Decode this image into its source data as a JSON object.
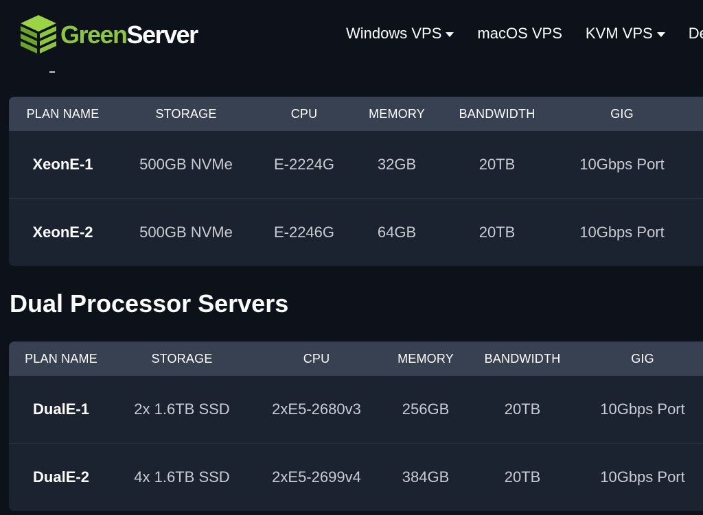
{
  "brand": {
    "name_green": "Green",
    "name_white": "Server",
    "accent_color": "#8cc63f",
    "logo_icon": "stacked-cube-icon"
  },
  "nav": {
    "items": [
      {
        "label": "Windows VPS",
        "has_dropdown": true
      },
      {
        "label": "macOS VPS",
        "has_dropdown": false
      },
      {
        "label": "KVM VPS",
        "has_dropdown": true
      },
      {
        "label": "De",
        "has_dropdown": false
      }
    ]
  },
  "tables": {
    "xeon": {
      "headers": [
        "PLAN NAME",
        "STORAGE",
        "CPU",
        "MEMORY",
        "BANDWIDTH",
        "GIG"
      ],
      "rows": [
        [
          "XeonE-1",
          "500GB NVMe",
          "E-2224G",
          "32GB",
          "20TB",
          "10Gbps Port"
        ],
        [
          "XeonE-2",
          "500GB NVMe",
          "E-2246G",
          "64GB",
          "20TB",
          "10Gbps Port"
        ]
      ]
    },
    "dual": {
      "title": "Dual Processor Servers",
      "headers": [
        "PLAN NAME",
        "STORAGE",
        "CPU",
        "MEMORY",
        "BANDWIDTH",
        "GIG"
      ],
      "rows": [
        [
          "DualE-1",
          "2x 1.6TB SSD",
          "2xE5-2680v3",
          "256GB",
          "20TB",
          "10Gbps Port"
        ],
        [
          "DualE-2",
          "4x 1.6TB SSD",
          "2xE5-2699v4",
          "384GB",
          "20TB",
          "10Gbps Port"
        ]
      ]
    }
  },
  "colors": {
    "page_bg": "#0c111a",
    "table_head_bg": "#384152",
    "table_row_bg": "#1b2230"
  }
}
